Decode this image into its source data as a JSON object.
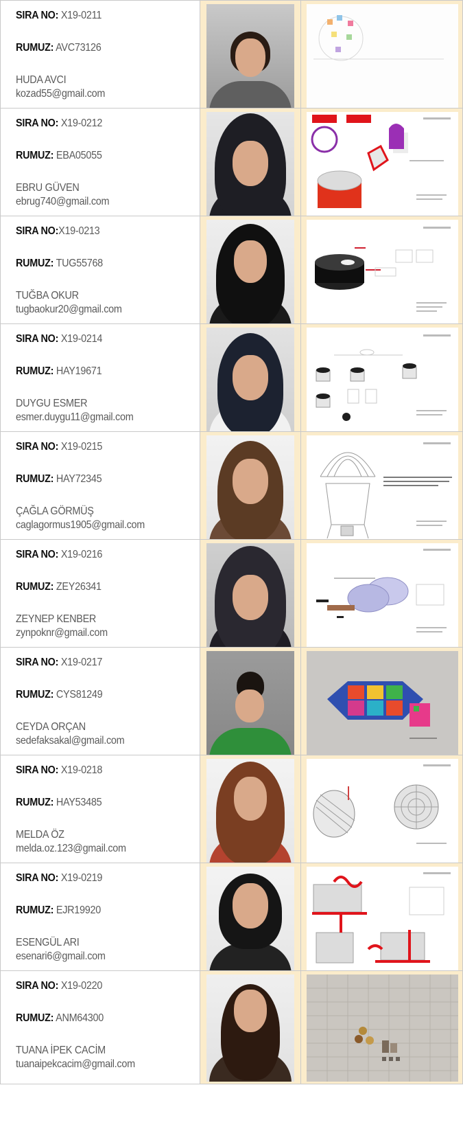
{
  "labels": {
    "sira": "SIRA NO:",
    "rumuz": "RUMUZ:"
  },
  "entries": [
    {
      "sira": " X19-0211",
      "rumuz": " AVC73126",
      "name": "HUDA AVCI",
      "email": "kozad55@gmail.com"
    },
    {
      "sira": " X19-0212",
      "rumuz": " EBA05055",
      "name": "EBRU GÜVEN",
      "email": "ebrug740@gmail.com"
    },
    {
      "sira": "X19-0213",
      "rumuz": " TUG55768",
      "name": "TUĞBA OKUR",
      "email": "tugbaokur20@gmail.com"
    },
    {
      "sira": " X19-0214",
      "rumuz": " HAY19671",
      "name": "DUYGU ESMER",
      "email": "esmer.duygu11@gmail.com"
    },
    {
      "sira": " X19-0215",
      "rumuz": " HAY72345",
      "name": "ÇAĞLA GÖRMÜŞ",
      "email": "caglagormus1905@gmail.com"
    },
    {
      "sira": " X19-0216",
      "rumuz": " ZEY26341",
      "name": "ZEYNEP KENBER",
      "email": "zynpoknr@gmail.com"
    },
    {
      "sira": " X19-0217",
      "rumuz": " CYS81249",
      "name": "CEYDA ORÇAN",
      "email": "sedefaksakal@gmail.com"
    },
    {
      "sira": " X19-0218",
      "rumuz": " HAY53485",
      "name": "MELDA ÖZ",
      "email": "melda.oz.123@gmail.com"
    },
    {
      "sira": " X19-0219",
      "rumuz": " EJR19920",
      "name": "ESENGÜL ARI",
      "email": "esenari6@gmail.com"
    },
    {
      "sira": " X19-0220",
      "rumuz": " ANM64300",
      "name": "TUANA İPEK CACİM",
      "email": "tuanaipekcacim@gmail.com"
    }
  ],
  "theme": {
    "cell_bg": "#fbeccb",
    "border": "#c9c9c9",
    "text": "#5a5a5a",
    "label": "#111111"
  }
}
